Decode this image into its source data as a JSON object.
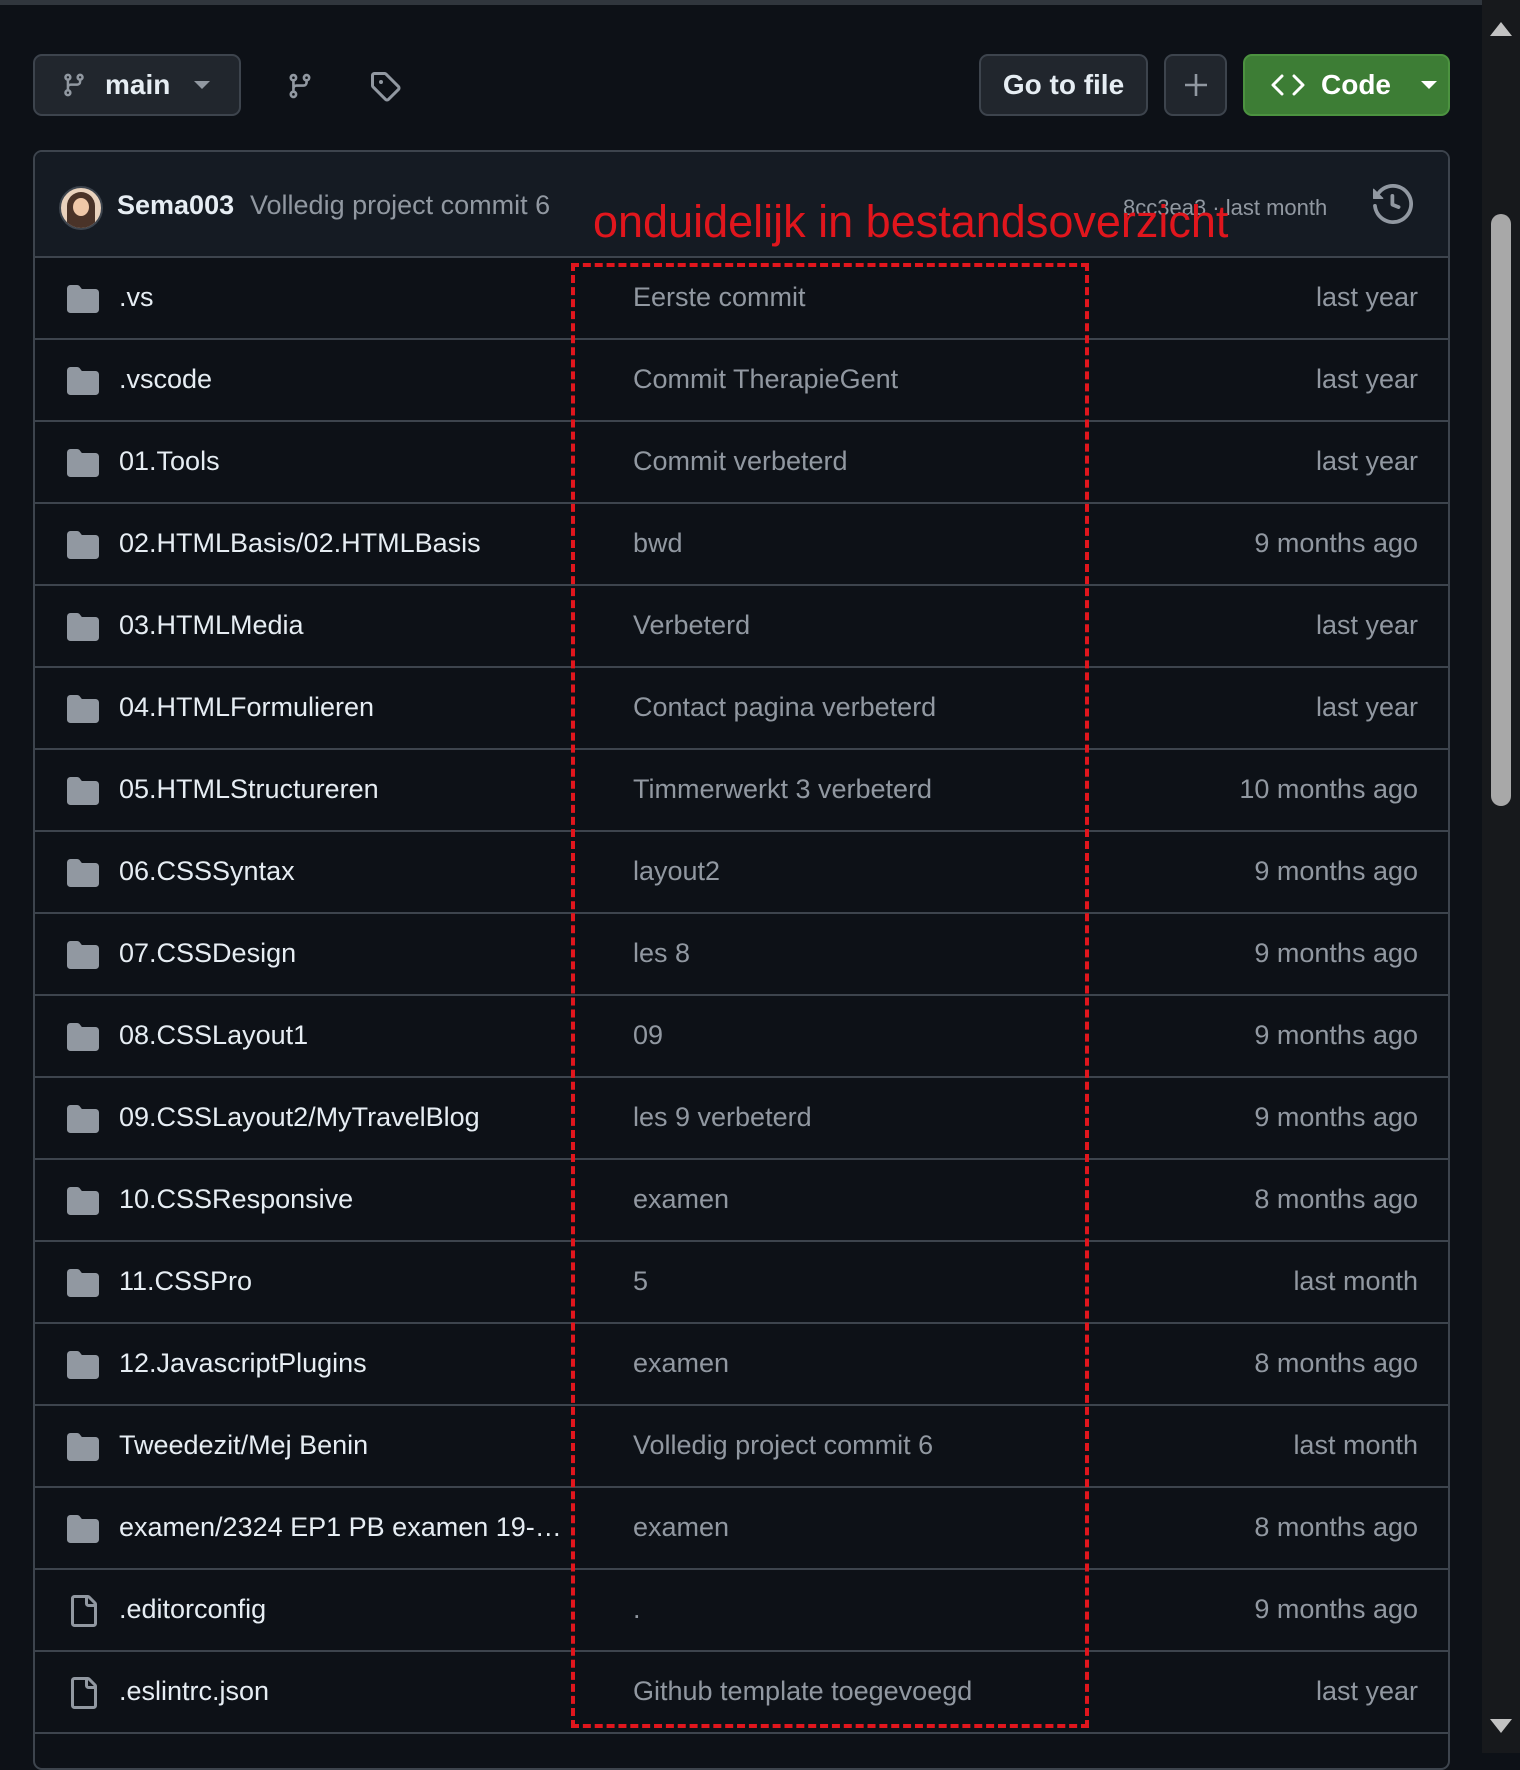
{
  "toolbar": {
    "branch_label": "main",
    "goto_label": "Go to file",
    "code_label": "Code"
  },
  "commit": {
    "author": "Sema003",
    "message": "Volledig project commit 6",
    "meta": "8cc3ea3 · last month"
  },
  "annotation": {
    "text": "onduidelijk in bestandsoverzicht",
    "color": "#e0161d"
  },
  "files": [
    {
      "type": "folder",
      "name": ".vs",
      "message": "Eerste commit",
      "date": "last year"
    },
    {
      "type": "folder",
      "name": ".vscode",
      "message": "Commit TherapieGent",
      "date": "last year"
    },
    {
      "type": "folder",
      "name": "01.Tools",
      "message": "Commit verbeterd",
      "date": "last year"
    },
    {
      "type": "folder",
      "name": "02.HTMLBasis/02.HTMLBasis",
      "message": "bwd",
      "date": "9 months ago"
    },
    {
      "type": "folder",
      "name": "03.HTMLMedia",
      "message": "Verbeterd",
      "date": "last year"
    },
    {
      "type": "folder",
      "name": "04.HTMLFormulieren",
      "message": "Contact pagina verbeterd",
      "date": "last year"
    },
    {
      "type": "folder",
      "name": "05.HTMLStructureren",
      "message": "Timmerwerkt 3 verbeterd",
      "date": "10 months ago"
    },
    {
      "type": "folder",
      "name": "06.CSSSyntax",
      "message": "layout2",
      "date": "9 months ago"
    },
    {
      "type": "folder",
      "name": "07.CSSDesign",
      "message": "les 8",
      "date": "9 months ago"
    },
    {
      "type": "folder",
      "name": "08.CSSLayout1",
      "message": "09",
      "date": "9 months ago"
    },
    {
      "type": "folder",
      "name": "09.CSSLayout2/MyTravelBlog",
      "message": "les 9 verbeterd",
      "date": "9 months ago"
    },
    {
      "type": "folder",
      "name": "10.CSSResponsive",
      "message": "examen",
      "date": "8 months ago"
    },
    {
      "type": "folder",
      "name": "11.CSSPro",
      "message": "5",
      "date": "last month"
    },
    {
      "type": "folder",
      "name": "12.JavascriptPlugins",
      "message": "examen",
      "date": "8 months ago"
    },
    {
      "type": "folder",
      "name": "Tweedezit/Mej Benin",
      "message": "Volledig project commit 6",
      "date": "last month"
    },
    {
      "type": "folder",
      "name": "examen/2324 EP1 PB examen 19-0...",
      "message": "examen",
      "date": "8 months ago"
    },
    {
      "type": "file",
      "name": ".editorconfig",
      "message": ".",
      "date": "9 months ago"
    },
    {
      "type": "file",
      "name": ".eslintrc.json",
      "message": "Github template toegevoegd",
      "date": "last year"
    }
  ],
  "colors": {
    "background": "#0d1117",
    "code_button": "#3d7d35",
    "annotation": "#e0161d"
  }
}
